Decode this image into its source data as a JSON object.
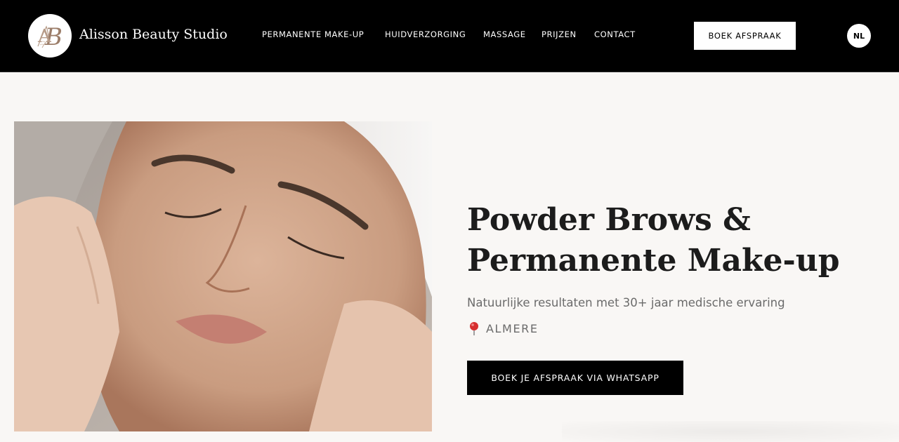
{
  "header": {
    "brand_name": "Alisson Beauty Studio",
    "logo_monogram": "AB",
    "nav": [
      {
        "label": "PERMANENTE MAKE-UP"
      },
      {
        "label": "HUIDVERZORGING"
      },
      {
        "label": "MASSAGE"
      },
      {
        "label": "PRIJZEN"
      },
      {
        "label": "CONTACT"
      }
    ],
    "book_button": "BOEK AFSPRAAK",
    "language": "NL"
  },
  "hero": {
    "image_icon": "face-treatment-photo",
    "title_line1": "Powder Brows &",
    "title_line2": "Permanente Make-up",
    "subtitle": "Natuurlijke resultaten met 30+ jaar medische ervaring",
    "location_icon": "pin-icon",
    "location": "ALMERE",
    "cta_button": "BOEK JE AFSPRAAK VIA WHATSAPP"
  },
  "colors": {
    "header_bg": "#000000",
    "page_bg": "#f9f7f5",
    "accent": "#b08a72",
    "button_dark": "#000000"
  }
}
